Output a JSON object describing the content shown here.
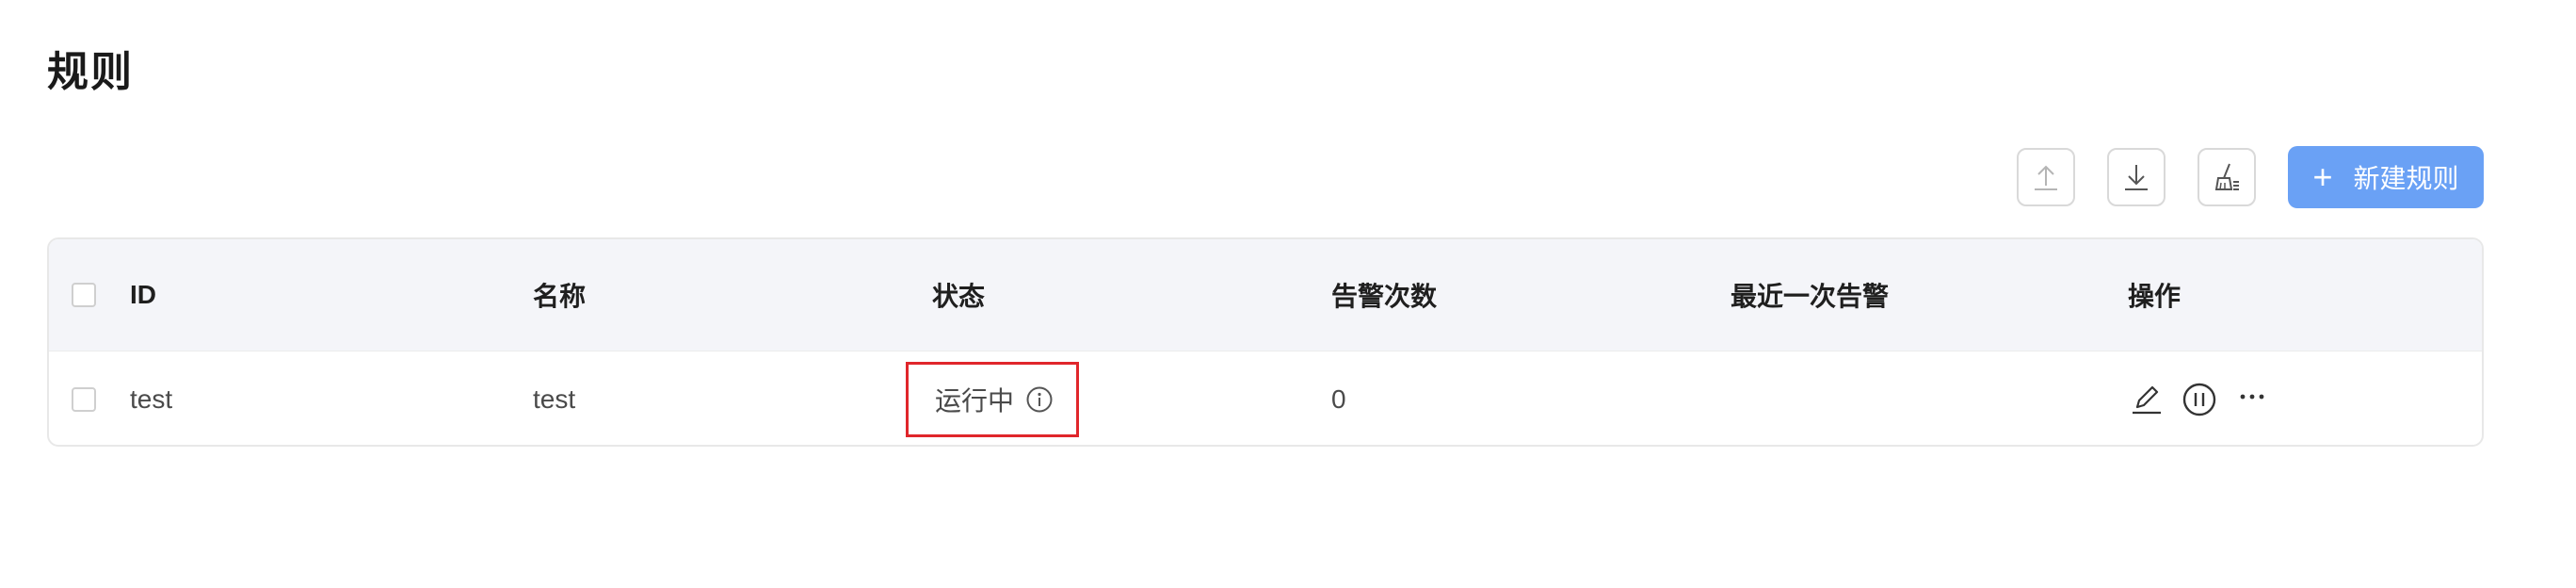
{
  "page": {
    "title": "规则"
  },
  "toolbar": {
    "upload_icon": "upload-icon",
    "download_icon": "download-icon",
    "clear_icon": "broom-icon",
    "new_rule_label": "新建规则"
  },
  "table": {
    "columns": [
      "ID",
      "名称",
      "状态",
      "告警次数",
      "最近一次告警",
      "操作"
    ],
    "rows": [
      {
        "id": "test",
        "name": "test",
        "status": "运行中",
        "alert_count": "0",
        "last_alert": ""
      }
    ]
  },
  "colors": {
    "primary": "#6aa1f5",
    "link": "#3d86e6",
    "highlight": "#e0262b",
    "header_bg": "#f4f5f9"
  }
}
